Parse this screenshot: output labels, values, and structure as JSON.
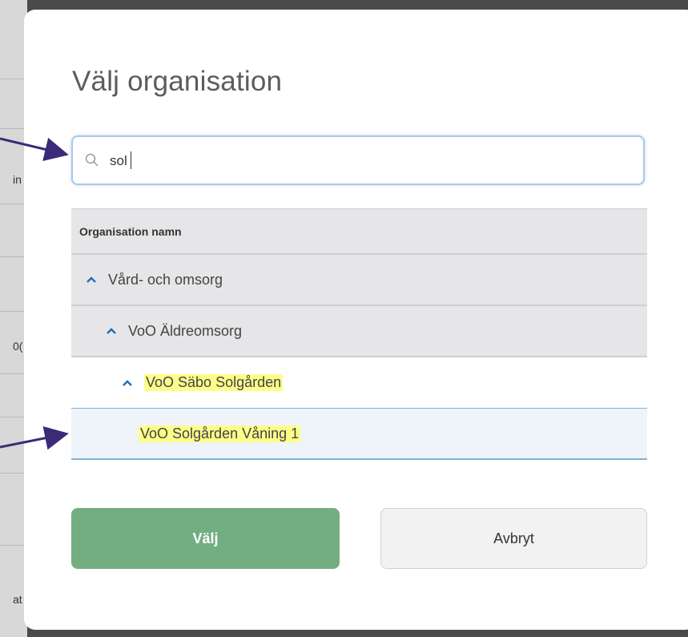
{
  "background_fragments": [
    "in",
    "0(",
    "at"
  ],
  "dialog": {
    "title": "Välj organisation",
    "search": {
      "value": "sol",
      "placeholder": ""
    },
    "table": {
      "header": "Organisation namn",
      "rows": [
        {
          "label": "Vård- och omsorg",
          "level": 0,
          "expanded": true,
          "highlight": ""
        },
        {
          "label": "VoO Äldreomsorg",
          "level": 1,
          "expanded": true,
          "highlight": ""
        },
        {
          "label": "VoO Säbo Solgården",
          "level": 2,
          "expanded": true,
          "highlight": "VoO Säbo Solgården"
        },
        {
          "label": "VoO Solgården Våning 1",
          "level": 3,
          "expanded": false,
          "highlight": "VoO Solgården Våning 1",
          "selected": true
        }
      ]
    },
    "buttons": {
      "select": "Välj",
      "cancel": "Avbryt"
    }
  },
  "colors": {
    "accent_blue": "#1e6fb8",
    "primary_button": "#73ae82",
    "highlight": "#fdfd8a",
    "arrow": "#3b2a78"
  }
}
